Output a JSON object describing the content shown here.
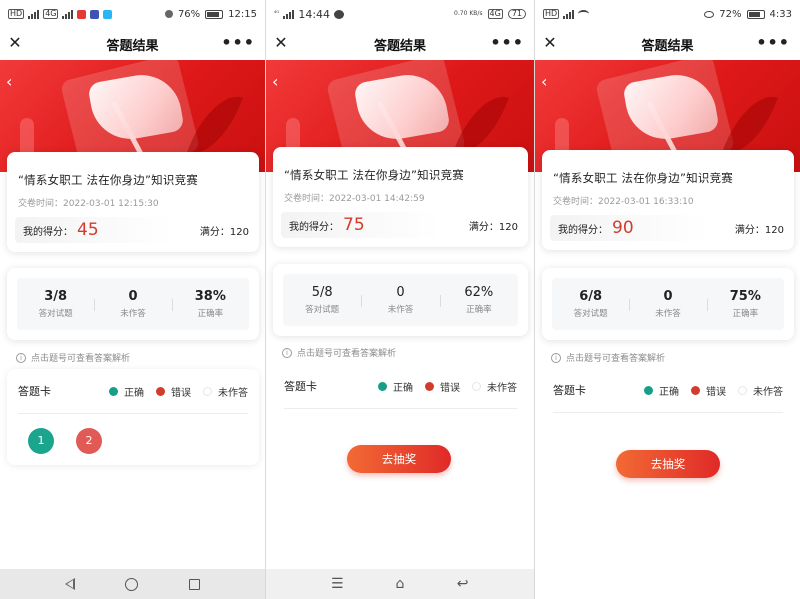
{
  "app": {
    "title": "答题结果"
  },
  "common": {
    "exam_title": "“情系女职工 法在你身边”知识竞赛",
    "submit_prefix": "交卷时间：",
    "score_label": "我的得分：",
    "full_label": "满分：",
    "full_score": "120",
    "stat_labels": {
      "correct": "答对试题",
      "unanswered": "未作答",
      "rate": "正确率"
    },
    "tip": "点击题号可查看答案解析",
    "answer_card_label": "答题卡",
    "legend": {
      "correct": "正确",
      "wrong": "错误",
      "unanswered": "未作答"
    },
    "lottery_button": "去抽奖",
    "colors": {
      "brand_red": "#de1818",
      "score_red": "#d23c2c",
      "correct_green": "#189e87",
      "lottery_orange": "#f26a34"
    }
  },
  "screens": [
    {
      "status": {
        "battery": "76%",
        "time": "12:15"
      },
      "submit_time": "2022-03-01 12:15:30",
      "score": "45",
      "stats": {
        "correct": "3/8",
        "unanswered": "0",
        "rate": "38%"
      },
      "questions": [
        {
          "number": "1",
          "result": "correct"
        },
        {
          "number": "2",
          "result": "wrong"
        }
      ]
    },
    {
      "status": {
        "time": "14:44",
        "battery": "71",
        "speed": "0.70 KB/s",
        "network": "4G"
      },
      "submit_time": "2022-03-01 14:42:59",
      "score": "75",
      "stats": {
        "correct": "5/8",
        "unanswered": "0",
        "rate": "62%"
      }
    },
    {
      "status": {
        "battery": "72%",
        "time": "4:33"
      },
      "submit_time": "2022-03-01 16:33:10",
      "score": "90",
      "stats": {
        "correct": "6/8",
        "unanswered": "0",
        "rate": "75%"
      }
    }
  ],
  "system": {
    "hd_tag": "HD",
    "network_tag": "4G"
  }
}
